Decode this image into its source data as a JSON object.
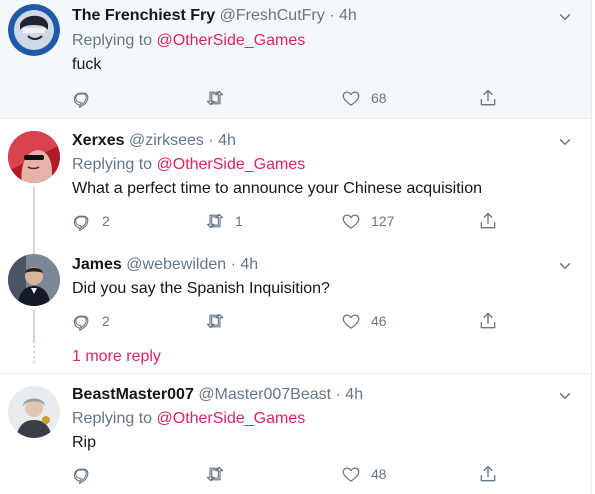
{
  "tweets": [
    {
      "name": "The Frenchiest Fry",
      "handle": "@FreshCutFry",
      "time": "4h",
      "replying_to_label": "Replying to",
      "replying_to": "@OtherSide_Games",
      "text": "fuck",
      "replies": "",
      "retweets": "",
      "likes": "68"
    },
    {
      "name": "Xerxes",
      "handle": "@zirksees",
      "time": "4h",
      "replying_to_label": "Replying to",
      "replying_to": "@OtherSide_Games",
      "text": "What a perfect time to announce your Chinese acquisition",
      "replies": "2",
      "retweets": "1",
      "likes": "127"
    },
    {
      "name": "James",
      "handle": "@webewilden",
      "time": "4h",
      "text": "Did you say the Spanish Inquisition?",
      "replies": "2",
      "retweets": "",
      "likes": "46"
    },
    {
      "name": "BeastMaster007",
      "handle": "@Master007Beast",
      "time": "4h",
      "replying_to_label": "Replying to",
      "replying_to": "@OtherSide_Games",
      "text": "Rip",
      "replies": "",
      "retweets": "",
      "likes": "48"
    }
  ],
  "thread": {
    "more_replies_label": "1 more reply"
  },
  "separator": "·",
  "icons": [
    "reply-icon",
    "retweet-icon",
    "like-icon",
    "share-icon",
    "chevron-down-icon"
  ],
  "colors": {
    "accent": "#e0245e",
    "muted": "#657786",
    "text": "#14171a",
    "divider": "#e6ecf0",
    "highlight": "#f5f8fa"
  }
}
